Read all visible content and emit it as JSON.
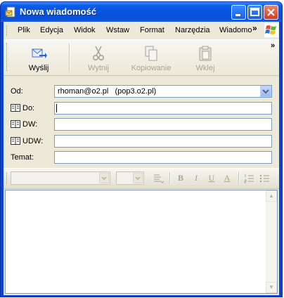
{
  "window": {
    "title": "Nowa wiadomość"
  },
  "menu": {
    "items": [
      "Plik",
      "Edycja",
      "Widok",
      "Wstaw",
      "Format",
      "Narzędzia",
      "Wiadomo"
    ]
  },
  "toolbar": {
    "send_label": "Wyślij",
    "cut_label": "Wytnij",
    "copy_label": "Kopiowanie",
    "paste_label": "Wklej"
  },
  "header": {
    "from_label": "Od:",
    "from_value": "rhoman@o2.pl   (pop3.o2.pl)",
    "to_label": "Do:",
    "to_value": "",
    "cc_label": "DW:",
    "cc_value": "",
    "bcc_label": "UDW:",
    "bcc_value": "",
    "subject_label": "Temat:",
    "subject_value": ""
  },
  "format": {
    "bold": "B",
    "italic": "I",
    "underline": "U",
    "color": "A"
  },
  "colors": {
    "title_bar": "#0553e0",
    "window_bg": "#ece9d8",
    "field_border": "#7f9db9",
    "disabled_text": "#a7a493"
  }
}
